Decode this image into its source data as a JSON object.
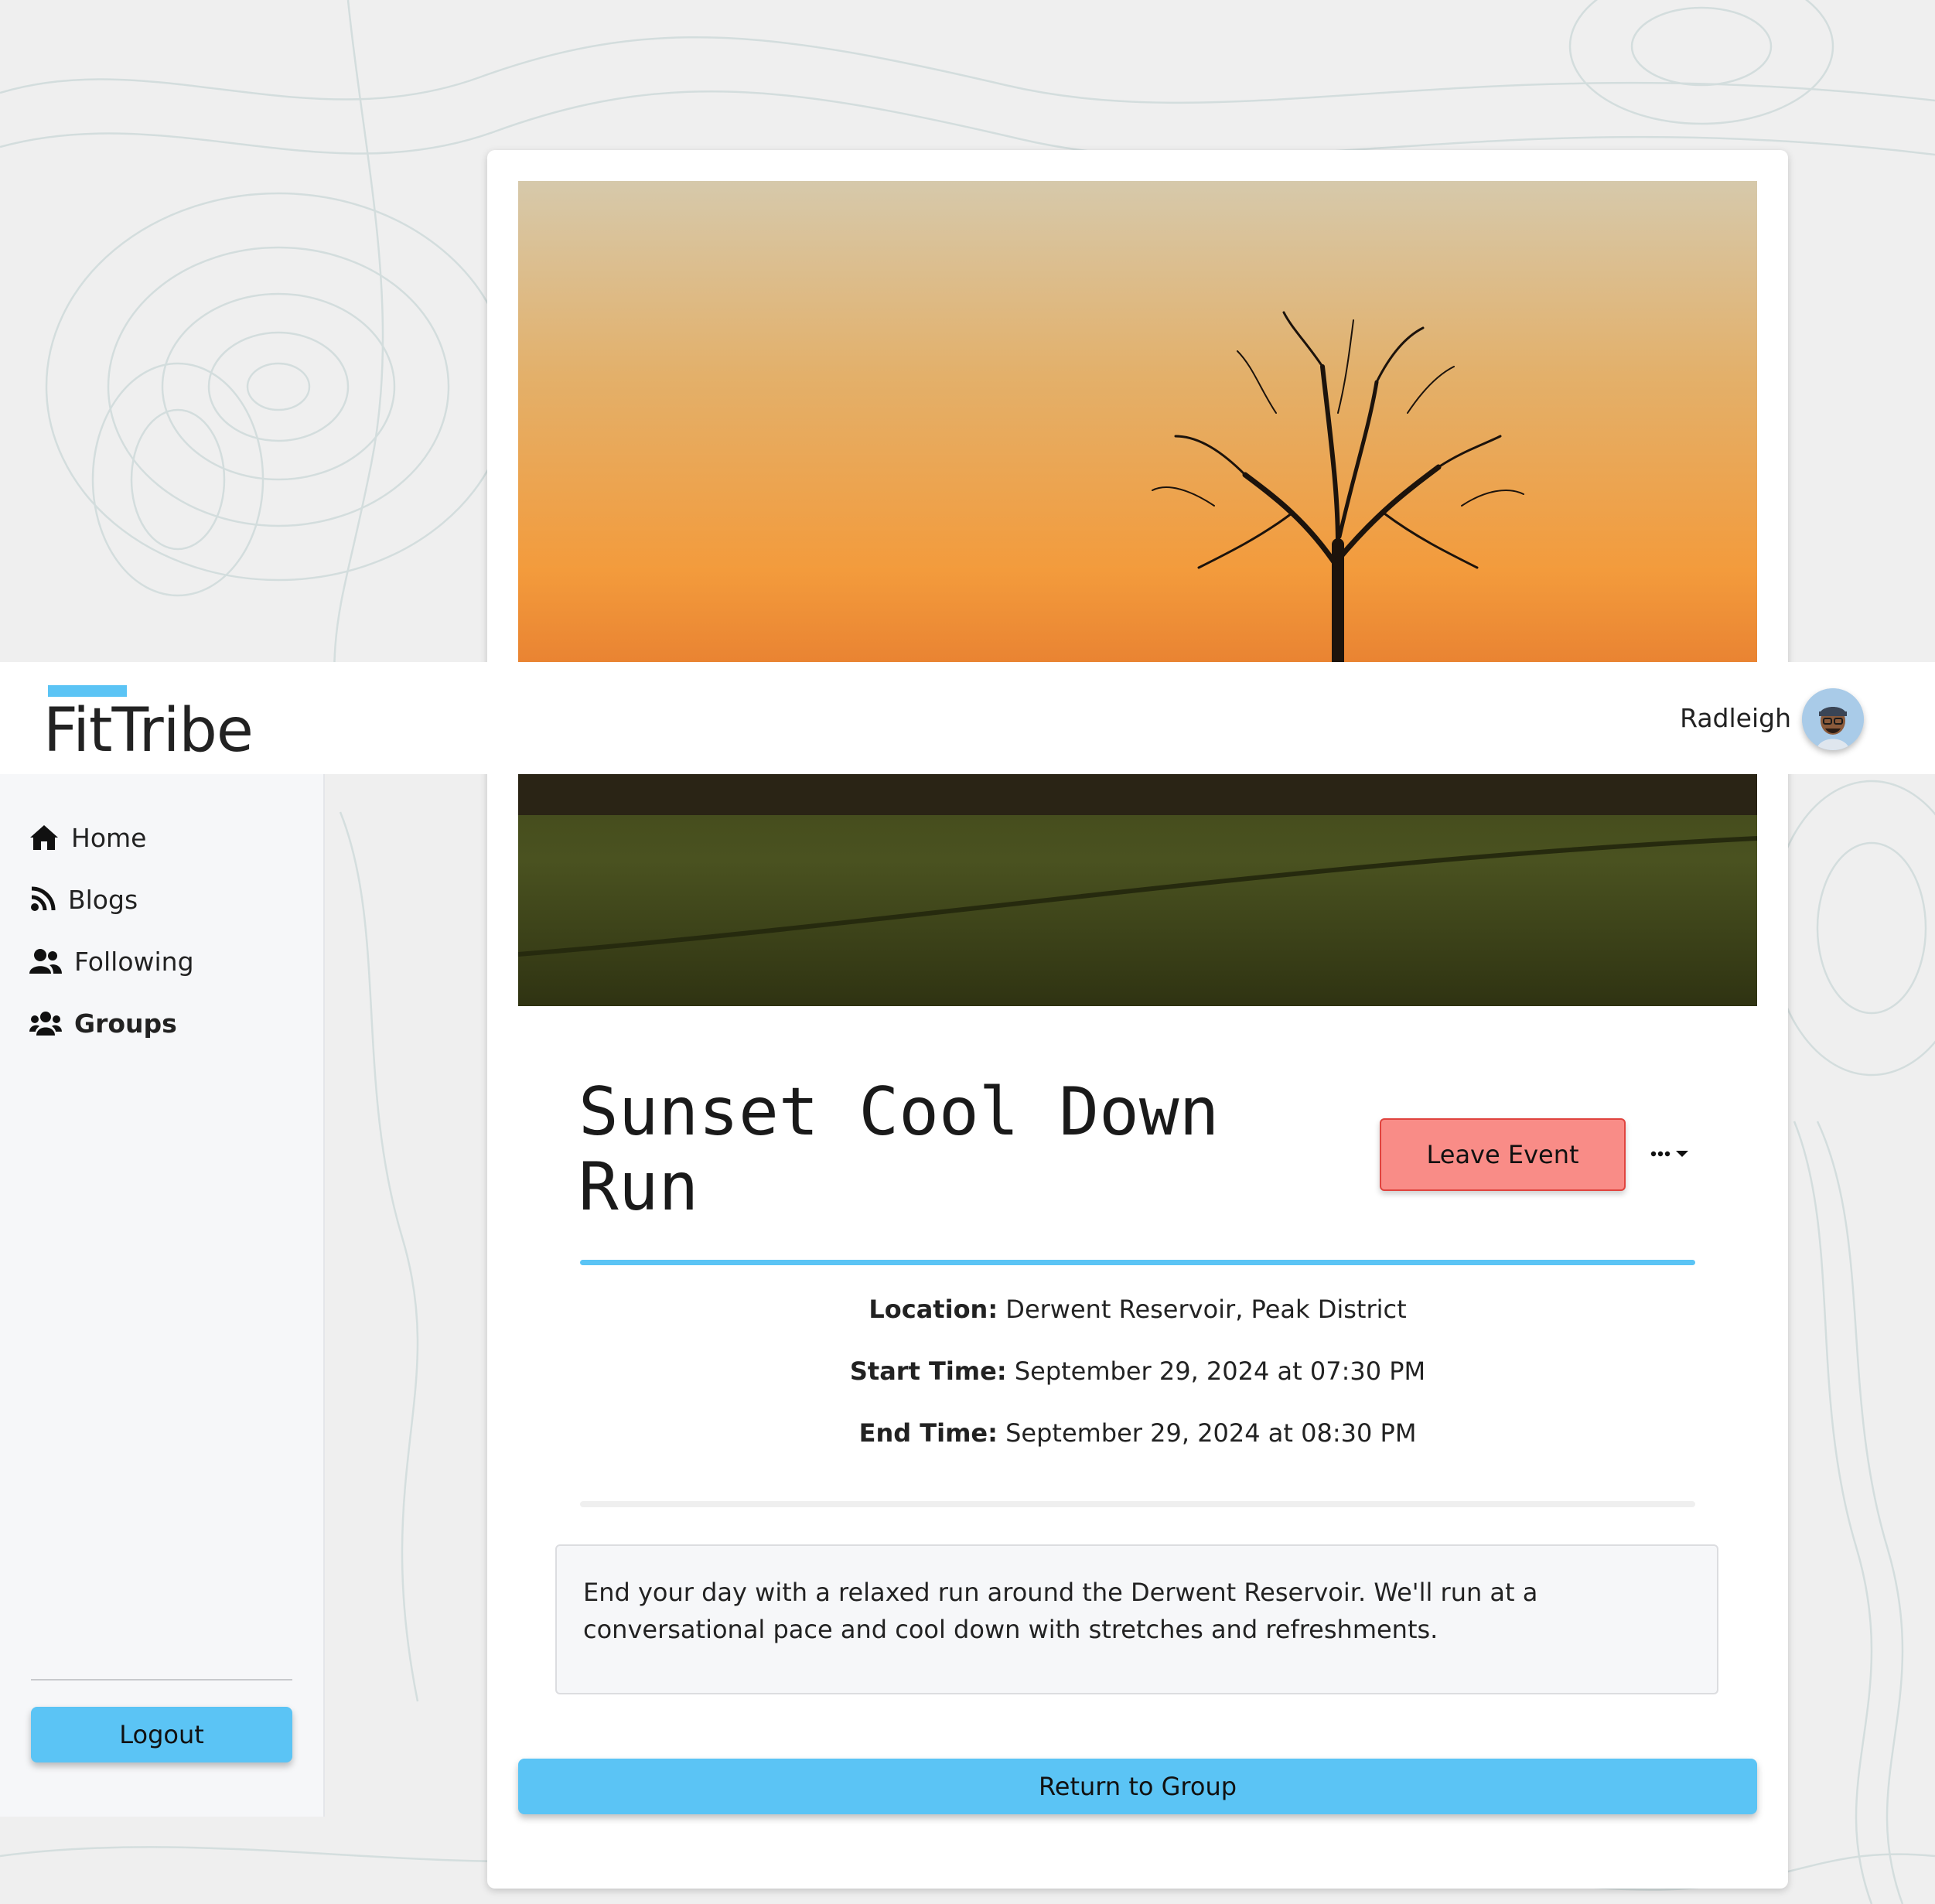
{
  "brand": {
    "name": "FitTribe",
    "accent": "#5bc4f5"
  },
  "header": {
    "username": "Radleigh",
    "avatar_icon": "user-avatar"
  },
  "sidebar": {
    "items": [
      {
        "label": "Home",
        "icon": "home-icon",
        "active": false
      },
      {
        "label": "Blogs",
        "icon": "rss-icon",
        "active": false
      },
      {
        "label": "Following",
        "icon": "user-friends-icon",
        "active": false
      },
      {
        "label": "Groups",
        "icon": "users-icon",
        "active": true
      }
    ],
    "logout_label": "Logout"
  },
  "event": {
    "title": "Sunset Cool Down Run",
    "leave_label": "Leave Event",
    "more_icon": "ellipsis-dropdown-icon",
    "location_key": "Location:",
    "location_value": "Derwent Reservoir, Peak District",
    "start_key": "Start Time:",
    "start_value": "September 29, 2024 at 07:30 PM",
    "end_key": "End Time:",
    "end_value": "September 29, 2024 at 08:30 PM",
    "description": "End your day with a relaxed run around the Derwent Reservoir. We'll run at a conversational pace and cool down with stretches and refreshments.",
    "return_label": "Return to Group"
  },
  "colors": {
    "primary": "#5bc4f5",
    "danger": "#f98c87",
    "danger_border": "#e0443f"
  }
}
